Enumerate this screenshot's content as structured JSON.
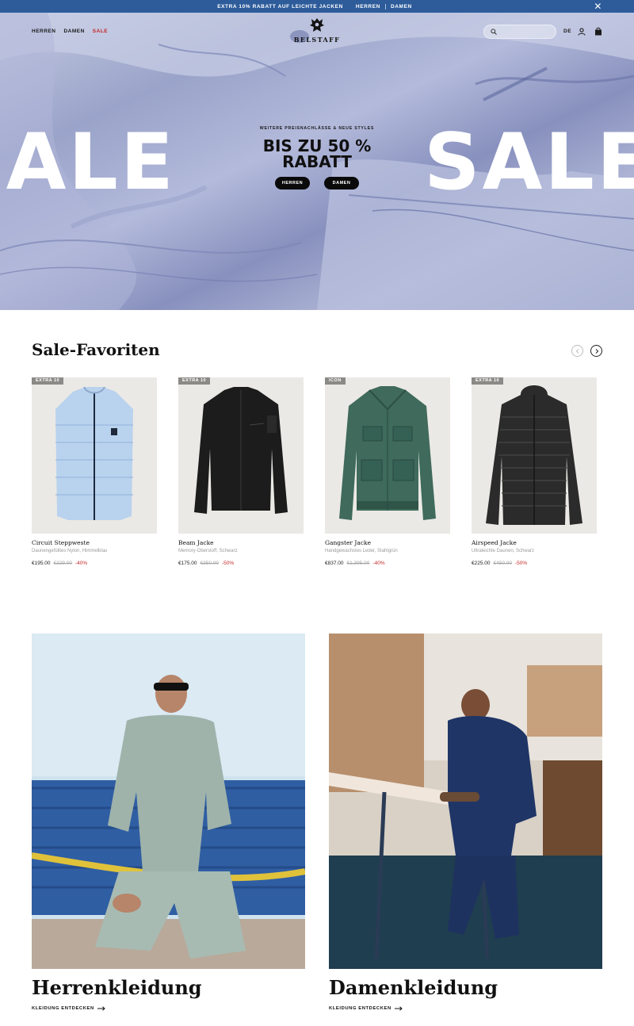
{
  "promo": {
    "text": "EXTRA 10% RABATT AUF LEICHTE JACKEN",
    "link_men": "HERREN",
    "link_women": "DAMEN",
    "close_label": "✕"
  },
  "nav": {
    "items": [
      "HERREN",
      "DAMEN",
      "SALE"
    ],
    "brand": "BELSTAFF",
    "search_placeholder": "",
    "language": "DE"
  },
  "hero": {
    "big_text": "SALE",
    "kicker": "WEITERE PREISNACHLÄSSE & NEUE STYLES",
    "title_line1": "BIS ZU 50 %",
    "title_line2": "RABATT",
    "btn_men": "HERREN",
    "btn_women": "DAMEN"
  },
  "favorites": {
    "title": "Sale-Favoriten",
    "products": [
      {
        "badge": "EXTRA 10",
        "name": "Circuit Steppweste",
        "desc": "Daunengefülltes Nylon, Himmelblau",
        "price": "€195.00",
        "was": "€229.00",
        "off": "-40%"
      },
      {
        "badge": "EXTRA 10",
        "name": "Beam Jacke",
        "desc": "Memory-Oberstoff, Schwarz",
        "price": "€175.00",
        "was": "€350.00",
        "off": "-50%"
      },
      {
        "badge": "ICON",
        "name": "Gangster Jacke",
        "desc": "Handgewachstes Leder, Stahlgrün",
        "price": "€837.00",
        "was": "€1,395.00",
        "off": "-40%"
      },
      {
        "badge": "EXTRA 10",
        "name": "Airspeed Jacke",
        "desc": "Ultraleichte Daunen, Schwarz",
        "price": "€225.00",
        "was": "€450.00",
        "off": "-50%"
      }
    ]
  },
  "tiles": {
    "men_title": "Herrenkleidung",
    "men_link": "KLEIDUNG ENTDECKEN",
    "women_title": "Damenkleidung",
    "women_link": "KLEIDUNG ENTDECKEN"
  },
  "colors": {
    "promo_bg": "#2e5c9a",
    "sale_red": "#c62828",
    "hero_tint": "#9aa3c9"
  }
}
